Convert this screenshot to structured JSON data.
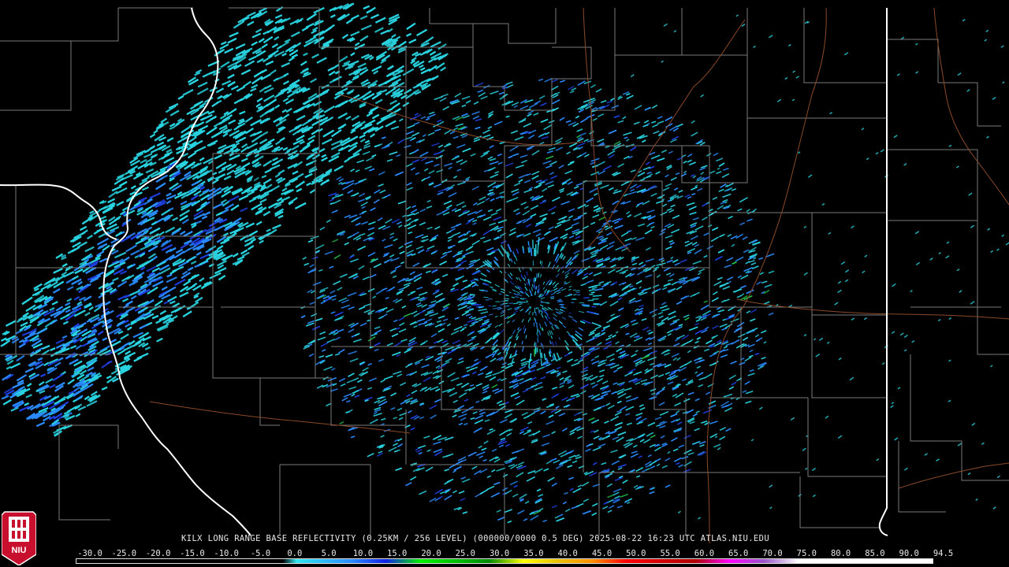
{
  "product": {
    "caption": "KILX LONG RANGE BASE REFLECTIVITY (0.25KM / 256 LEVEL) (000000/0000 0.5 DEG) 2025-08-22 16:23 UTC  ATLAS.NIU.EDU"
  },
  "logo": {
    "text": "NIU",
    "color": "#c8102e"
  },
  "colors": {
    "background": "#000000",
    "county_lines": "#7a7a7a",
    "state_lines": "#ffffff",
    "rivers": "#8b4a2a",
    "echo_light": "#29d3e0",
    "echo_medium": "#2a8cff",
    "echo_strong": "#1f3fe0",
    "echo_green": "#25c24a"
  },
  "scale": {
    "labels": [
      "-30.0",
      "-25.0",
      "-20.0",
      "-15.0",
      "-10.0",
      "-5.0",
      "0.0",
      "5.0",
      "10.0",
      "15.0",
      "20.0",
      "25.0",
      "30.0",
      "35.0",
      "40.0",
      "45.0",
      "50.0",
      "55.0",
      "60.0",
      "65.0",
      "70.0",
      "75.0",
      "80.0",
      "85.0",
      "90.0",
      "94.5"
    ],
    "stops": [
      {
        "value": -30,
        "color": "#000000"
      },
      {
        "value": 0,
        "color": "#000000"
      },
      {
        "value": 2,
        "color": "#30e6f0"
      },
      {
        "value": 10,
        "color": "#2a8cff"
      },
      {
        "value": 15,
        "color": "#1020e8"
      },
      {
        "value": 20,
        "color": "#00f000"
      },
      {
        "value": 25,
        "color": "#00c000"
      },
      {
        "value": 30,
        "color": "#008a00"
      },
      {
        "value": 35,
        "color": "#ffff00"
      },
      {
        "value": 40,
        "color": "#e8c000"
      },
      {
        "value": 45,
        "color": "#ff9000"
      },
      {
        "value": 50,
        "color": "#ff0000"
      },
      {
        "value": 55,
        "color": "#d40000"
      },
      {
        "value": 60,
        "color": "#b00000"
      },
      {
        "value": 65,
        "color": "#ff00ff"
      },
      {
        "value": 70,
        "color": "#9955c8"
      },
      {
        "value": 75,
        "color": "#ffffff"
      },
      {
        "value": 94.5,
        "color": "#ffffff"
      }
    ]
  }
}
